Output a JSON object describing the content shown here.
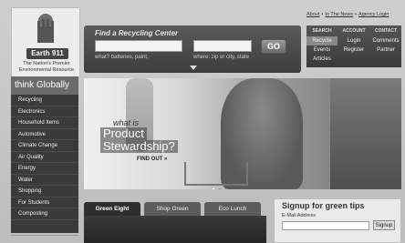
{
  "logo": {
    "badge": "Earth 911",
    "tagline": "The Nation's Premier Environmental Resource"
  },
  "search": {
    "title": "Find a Recycling Center",
    "go_label": "GO",
    "what_hint": "what? batteries, paint,",
    "where_hint": "where: zip or city, state"
  },
  "toplinks": [
    "About",
    "In The News",
    "Agency Login"
  ],
  "account": {
    "columns": [
      {
        "header": "SEARCH",
        "items": [
          "Recycle",
          "Events",
          "Articles"
        ]
      },
      {
        "header": "ACCOUNT",
        "items": [
          "Login",
          "Register"
        ]
      },
      {
        "header": "CONTACT",
        "items": [
          "Comments",
          "Partner"
        ]
      }
    ]
  },
  "nav": {
    "heading": "think Globally",
    "items": [
      "Recycling",
      "Electronics",
      "Household Items",
      "Automotive",
      "Climate Change",
      "Air Quality",
      "Energy",
      "Water",
      "Shopping",
      "For Students",
      "Composting"
    ]
  },
  "hero": {
    "what_is": "what is",
    "title_line1": "Product",
    "title_line2": "Stewardship?",
    "cta": "FIND OUT »"
  },
  "tabs": [
    "Green Eight",
    "Shop Green",
    "Eco Lunch"
  ],
  "signup": {
    "title": "Signup for green tips",
    "email_label": "E-Mail Address",
    "button": "Signup"
  }
}
